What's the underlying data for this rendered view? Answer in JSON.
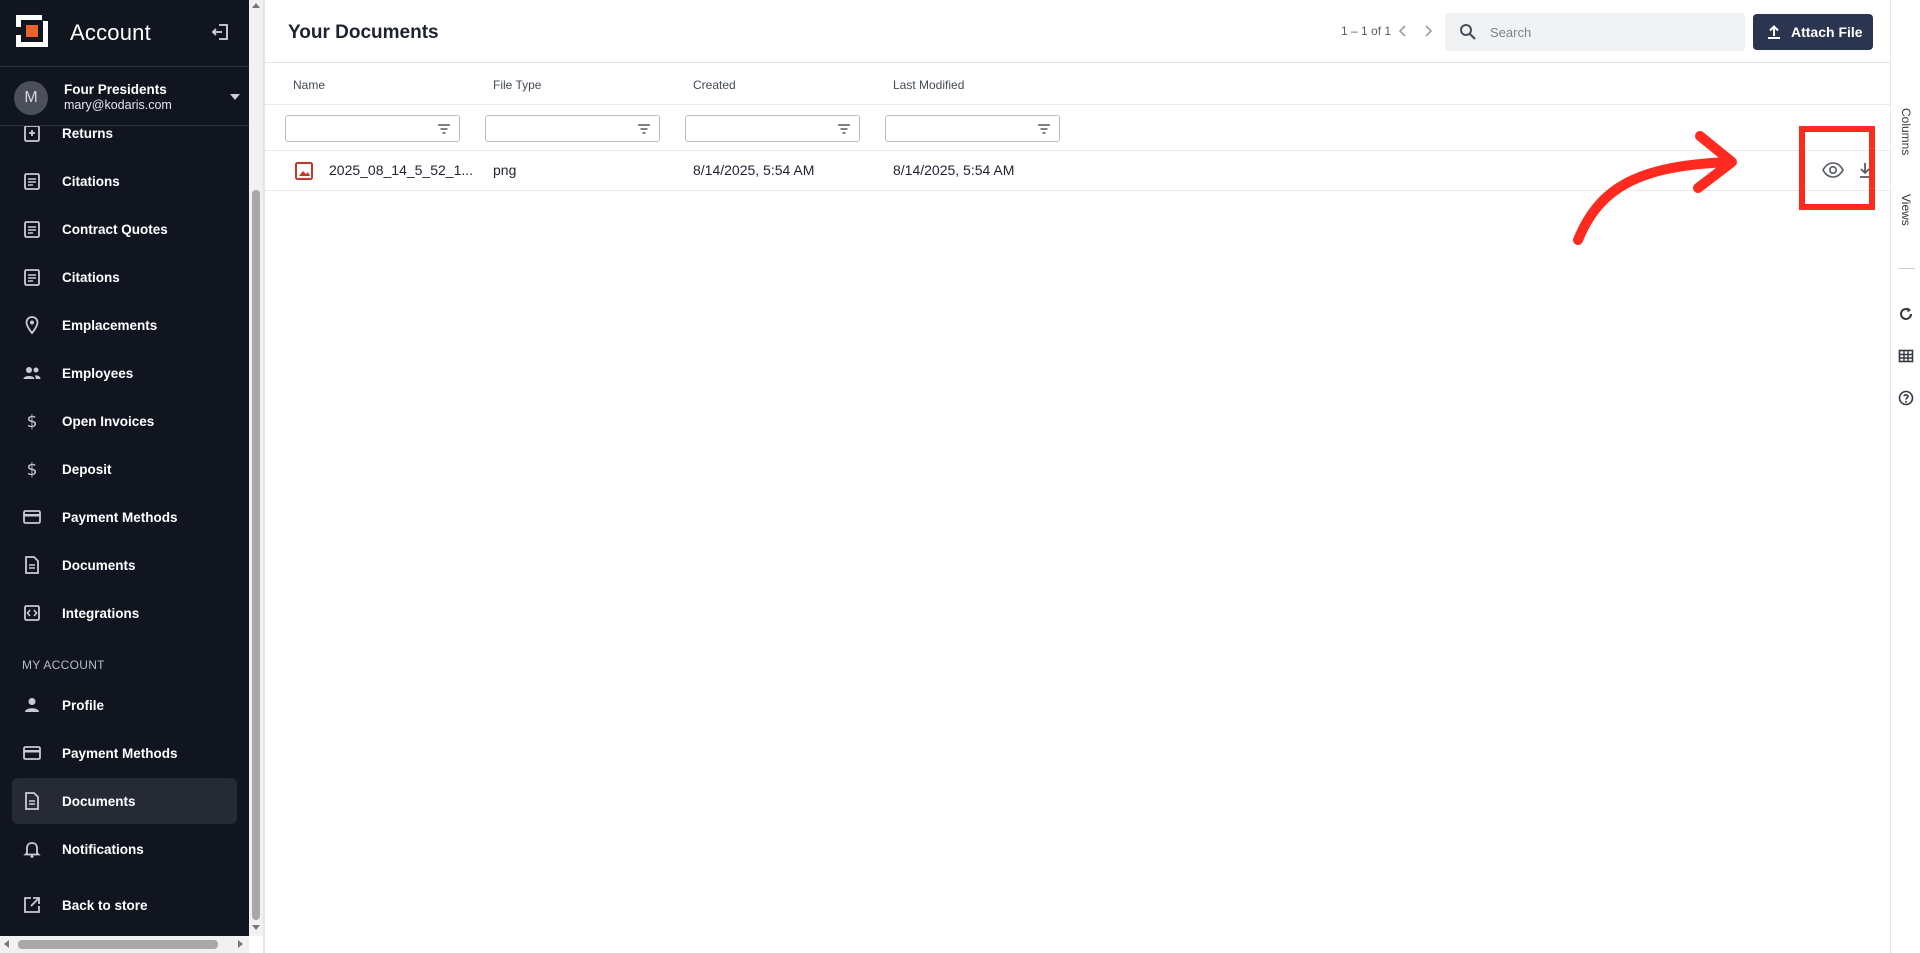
{
  "app": {
    "title": "Account"
  },
  "user": {
    "avatar_initial": "M",
    "name": "Four Presidents",
    "email": "mary@kodaris.com"
  },
  "sidebar": {
    "items": [
      {
        "label": "Returns",
        "icon": "return-icon"
      },
      {
        "label": "Citations",
        "icon": "clipboard-icon"
      },
      {
        "label": "Contract Quotes",
        "icon": "clipboard-icon"
      },
      {
        "label": "Citations",
        "icon": "clipboard-icon"
      },
      {
        "label": "Emplacements",
        "icon": "location-pin-icon"
      },
      {
        "label": "Employees",
        "icon": "people-icon"
      },
      {
        "label": "Open Invoices",
        "icon": "dollar-icon"
      },
      {
        "label": "Deposit",
        "icon": "dollar-icon"
      },
      {
        "label": "Payment Methods",
        "icon": "credit-card-icon"
      },
      {
        "label": "Documents",
        "icon": "document-icon"
      },
      {
        "label": "Integrations",
        "icon": "integration-icon"
      }
    ],
    "section_label": "MY ACCOUNT",
    "account_items": [
      {
        "label": "Profile",
        "icon": "person-icon"
      },
      {
        "label": "Payment Methods",
        "icon": "credit-card-icon"
      },
      {
        "label": "Documents",
        "icon": "document-icon",
        "active": true
      },
      {
        "label": "Notifications",
        "icon": "bell-icon"
      },
      {
        "label": "Back to store",
        "icon": "external-link-icon"
      }
    ]
  },
  "main": {
    "title": "Your Documents",
    "pagination": "1 – 1 of 1",
    "search_placeholder": "Search",
    "attach_label": "Attach File",
    "columns": [
      "Name",
      "File Type",
      "Created",
      "Last Modified"
    ],
    "rows": [
      {
        "name": "2025_08_14_5_52_1...",
        "file_type": "png",
        "created": "8/14/2025, 5:54 AM",
        "modified": "8/14/2025, 5:54 AM"
      }
    ]
  },
  "rail": {
    "tabs": [
      "Columns",
      "Views"
    ]
  },
  "colors": {
    "sidebar_bg": "#11151f",
    "accent_button": "#2b3550",
    "logo_orange": "#e8622a",
    "annotation_red": "#ff2a1f"
  }
}
